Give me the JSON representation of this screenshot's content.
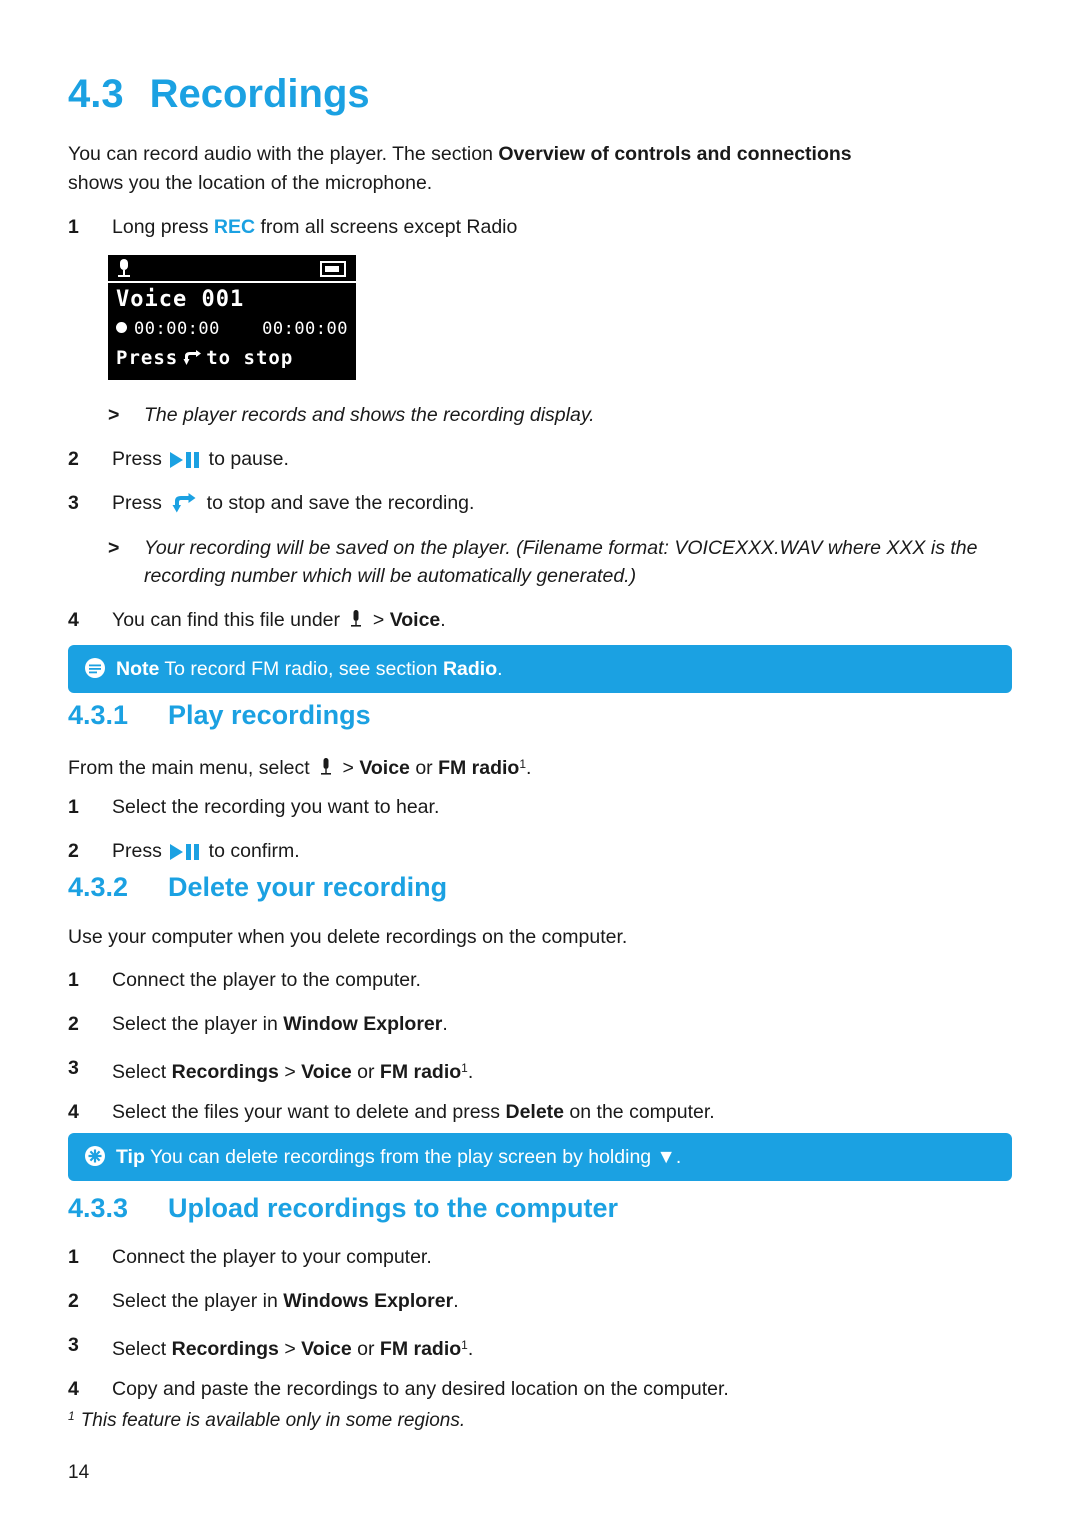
{
  "document": {
    "heading": {
      "number": "4.3",
      "title": "Recordings"
    },
    "intro": {
      "part1": "You can record audio with the player. The section ",
      "bold1": "Overview of controls and connections",
      "part2": " shows you the location of the microphone."
    },
    "steps_record": [
      {
        "n": "1",
        "pre": "Long press ",
        "highlight": "REC",
        "post": " from all screens except Radio"
      },
      {
        "n": "2",
        "pre": "Press ",
        "icon": "play-pause-icon",
        "post": " to pause."
      },
      {
        "n": "3",
        "pre": "Press ",
        "icon": "back-arrow-icon",
        "post": " to stop and save the recording."
      },
      {
        "n": "4",
        "pre": "You can find this file under ",
        "icon": "microphone-icon",
        "mid": " > ",
        "bold": "Voice",
        "post": "."
      }
    ],
    "note_after_step1": "The player records and shows the recording display.",
    "note_after_step3": "Your recording will be saved on the player. (Filename format: VOICEXXX.WAV where XXX is the recording number which will be automatically generated.)",
    "lcd": {
      "title": "Voice 001",
      "time_left": "00:00:00",
      "time_right": "00:00:00",
      "bottom_pre": "Press",
      "bottom_post": "to stop",
      "icons": {
        "top_left": "microphone-icon",
        "top_right": "battery-icon",
        "record": "record-dot-icon",
        "stop": "back-arrow-icon"
      }
    },
    "note_bar": {
      "icon": "note-icon",
      "label": "Note",
      "text_pre": " To record FM radio, see section ",
      "bold": "Radio",
      "text_post": "."
    },
    "tip_bar": {
      "icon": "tip-icon",
      "label": "Tip",
      "text": " You can delete recordings from the play screen by holding ",
      "glyph": "▼",
      "text_post": "."
    },
    "section_431": {
      "number": "4.3.1",
      "title": "Play recordings",
      "lead_pre": "From the main menu, select ",
      "lead_icon": "microphone-icon",
      "lead_mid": " > ",
      "lead_bold1": "Voice",
      "lead_or": " or ",
      "lead_bold2": "FM radio",
      "lead_sup": "1",
      "lead_post": ".",
      "steps": [
        {
          "n": "1",
          "text": "Select the recording you want to hear."
        },
        {
          "n": "2",
          "pre": "Press ",
          "icon": "play-pause-icon",
          "post": " to confirm."
        }
      ]
    },
    "section_432": {
      "number": "4.3.2",
      "title": "Delete your recording",
      "lead": "Use your computer when you delete recordings on the computer.",
      "steps": [
        {
          "n": "1",
          "text": "Connect the player to the computer."
        },
        {
          "n": "2",
          "pre": "Select the player in ",
          "bold": "Window Explorer",
          "post": "."
        },
        {
          "n": "3",
          "pre": "Select ",
          "bold": "Recordings",
          "mid": " > ",
          "bold2": "Voice",
          "or": " or ",
          "bold3": "FM radio",
          "sup": "1",
          "post": "."
        },
        {
          "n": "4",
          "pre": "Select the files your want to delete and press ",
          "bold": "Delete",
          "post": " on the computer."
        }
      ]
    },
    "section_433": {
      "number": "4.3.3",
      "title": "Upload recordings to the computer",
      "steps": [
        {
          "n": "1",
          "text": "Connect the player to your computer."
        },
        {
          "n": "2",
          "pre": "Select the player in ",
          "bold": "Windows Explorer",
          "post": "."
        },
        {
          "n": "3",
          "pre": "Select ",
          "bold": "Recordings",
          "mid": " > ",
          "bold2": "Voice",
          "or": " or ",
          "bold3": "FM radio",
          "sup": "1",
          "post": "."
        },
        {
          "n": "4",
          "text": "Copy and paste the recordings to any desired location on the computer."
        }
      ]
    },
    "footnote": {
      "marker": "1",
      "text": "This feature is available only in some regions."
    },
    "page_number": "14",
    "colors": {
      "accent": "#1ba1e2",
      "text": "#1a1a1a",
      "lcd_bg": "#000000"
    }
  }
}
